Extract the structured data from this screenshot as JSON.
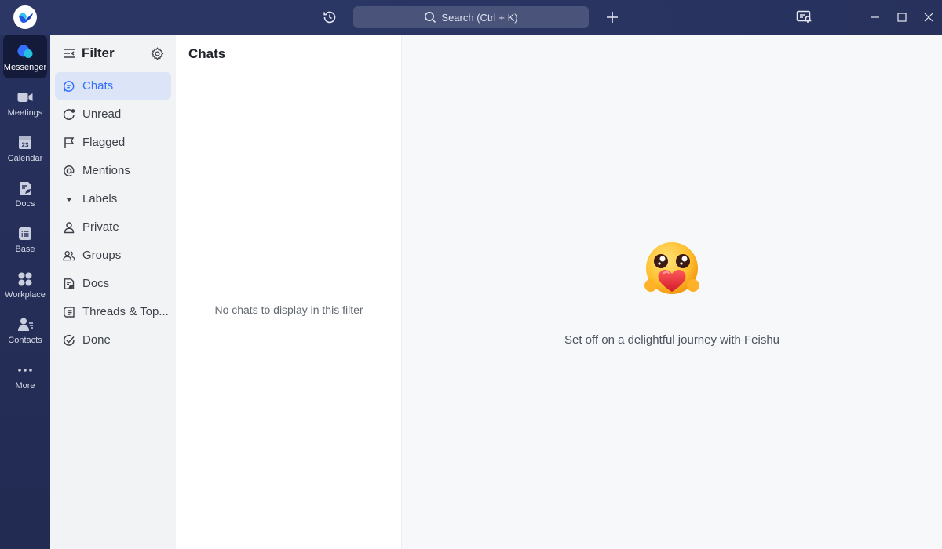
{
  "titlebar": {
    "search_placeholder": "Search (Ctrl + K)"
  },
  "rail": {
    "items": [
      {
        "label": "Messenger",
        "icon": "messenger-icon",
        "active": true
      },
      {
        "label": "Meetings",
        "icon": "video-camera-icon"
      },
      {
        "label": "Calendar",
        "icon": "calendar-icon",
        "badge": "23"
      },
      {
        "label": "Docs",
        "icon": "docs-icon"
      },
      {
        "label": "Base",
        "icon": "base-icon"
      },
      {
        "label": "Workplace",
        "icon": "workplace-grid-icon"
      },
      {
        "label": "Contacts",
        "icon": "contacts-icon"
      },
      {
        "label": "More",
        "icon": "more-dots-icon"
      }
    ]
  },
  "filter": {
    "title": "Filter",
    "items": [
      {
        "label": "Chats",
        "icon": "chat-bubble-icon",
        "active": true
      },
      {
        "label": "Unread",
        "icon": "unread-icon"
      },
      {
        "label": "Flagged",
        "icon": "flag-icon"
      },
      {
        "label": "Mentions",
        "icon": "at-icon"
      },
      {
        "label": "Labels",
        "icon": "caret-down-icon"
      },
      {
        "label": "Private",
        "icon": "person-icon"
      },
      {
        "label": "Groups",
        "icon": "group-icon"
      },
      {
        "label": "Docs",
        "icon": "doc-icon"
      },
      {
        "label": "Threads & Top...",
        "icon": "threads-icon"
      },
      {
        "label": "Done",
        "icon": "done-check-icon"
      }
    ]
  },
  "chats": {
    "title": "Chats",
    "empty_message": "No chats to display in this filter"
  },
  "main": {
    "message": "Set off on a delightful journey with Feishu"
  },
  "colors": {
    "accent": "#3370ff",
    "rail_bg": "#27315d",
    "active_filter_bg": "#dce5f7"
  }
}
